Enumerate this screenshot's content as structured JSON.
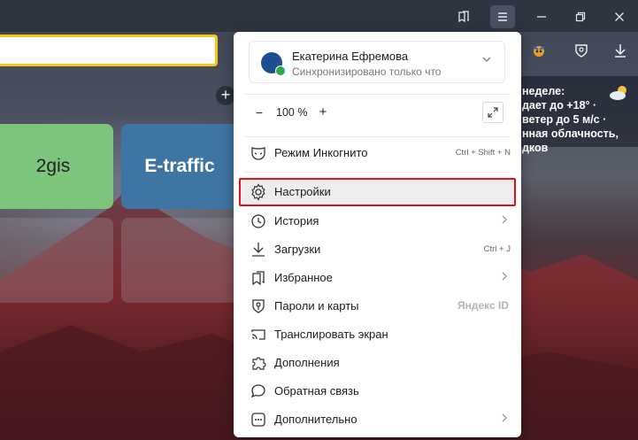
{
  "tiles": [
    {
      "label": "2gis"
    },
    {
      "label": "E-traffic"
    }
  ],
  "weather": {
    "line1": "неделе:",
    "line2": "дает до +18° ·",
    "line3": "ветер до 5 м/с ·",
    "line4": "нная облачность,",
    "line5": "дков"
  },
  "profile": {
    "name": "Екатерина Ефремова",
    "status": "Синхронизировано только что"
  },
  "zoom": {
    "minus": "−",
    "value": "100 %",
    "plus": "+"
  },
  "menu": {
    "incognito": {
      "label": "Режим Инкогнито",
      "shortcut": "Ctrl + Shift + N"
    },
    "settings": {
      "label": "Настройки"
    },
    "history": {
      "label": "История"
    },
    "downloads": {
      "label": "Загрузки",
      "shortcut": "Ctrl + J"
    },
    "bookmarks": {
      "label": "Избранное"
    },
    "passwords": {
      "label": "Пароли и карты",
      "badge": "Яндекс ID"
    },
    "cast": {
      "label": "Транслировать экран"
    },
    "extensions": {
      "label": "Дополнения"
    },
    "feedback": {
      "label": "Обратная связь"
    },
    "more": {
      "label": "Дополнительно"
    }
  },
  "colors": {
    "highlight_border": "#e0121c",
    "search_border": "#f5c518",
    "tile_2gis": "#7dc47c",
    "tile_etraffic": "#3f75a3"
  }
}
